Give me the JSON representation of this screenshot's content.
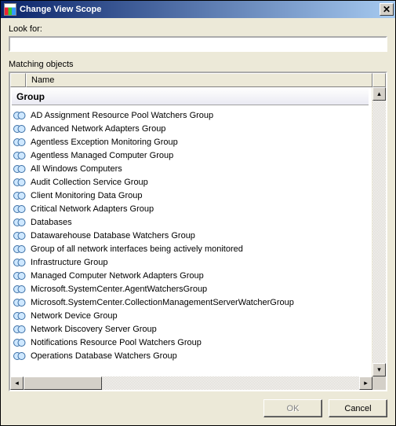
{
  "window": {
    "title": "Change View Scope"
  },
  "search": {
    "label": "Look for:",
    "value": ""
  },
  "list": {
    "caption": "Matching objects",
    "columns": {
      "name": "Name"
    },
    "group_header": "Group",
    "items": [
      "AD Assignment Resource Pool Watchers Group",
      "Advanced Network Adapters Group",
      "Agentless Exception Monitoring Group",
      "Agentless Managed Computer Group",
      "All Windows Computers",
      "Audit Collection Service Group",
      "Client Monitoring Data Group",
      "Critical Network Adapters Group",
      "Databases",
      "Datawarehouse Database Watchers Group",
      "Group of all network interfaces being actively monitored",
      "Infrastructure Group",
      "Managed Computer Network Adapters Group",
      "Microsoft.SystemCenter.AgentWatchersGroup",
      "Microsoft.SystemCenter.CollectionManagementServerWatcherGroup",
      "Network Device Group",
      "Network Discovery Server Group",
      "Notifications Resource Pool Watchers Group",
      "Operations Database Watchers Group"
    ]
  },
  "buttons": {
    "ok": "OK",
    "cancel": "Cancel"
  }
}
